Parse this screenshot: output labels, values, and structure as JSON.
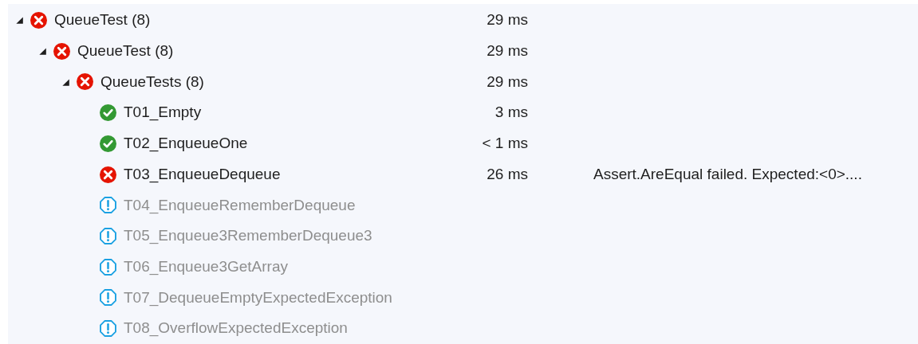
{
  "tree": [
    {
      "name": "QueueTest (8)",
      "kind": "failed",
      "duration": "29 ms",
      "expanded": true,
      "children": [
        {
          "name": "QueueTest (8)",
          "kind": "failed",
          "duration": "29 ms",
          "expanded": true,
          "children": [
            {
              "name": "QueueTests (8)",
              "kind": "failed",
              "duration": "29 ms",
              "expanded": true,
              "children": [
                {
                  "name": "T01_Empty",
                  "kind": "passed",
                  "duration": "3 ms"
                },
                {
                  "name": "T02_EnqueueOne",
                  "kind": "passed",
                  "duration": "< 1 ms"
                },
                {
                  "name": "T03_EnqueueDequeue",
                  "kind": "failed",
                  "duration": "26 ms",
                  "message": "Assert.AreEqual failed. Expected:<0>...."
                },
                {
                  "name": "T04_EnqueueRememberDequeue",
                  "kind": "not_run"
                },
                {
                  "name": "T05_Enqueue3RememberDequeue3",
                  "kind": "not_run"
                },
                {
                  "name": "T06_Enqueue3GetArray",
                  "kind": "not_run"
                },
                {
                  "name": "T07_DequeueEmptyExpectedException",
                  "kind": "not_run"
                },
                {
                  "name": "T08_OverflowExpectedException",
                  "kind": "not_run"
                }
              ]
            }
          ]
        }
      ]
    }
  ]
}
